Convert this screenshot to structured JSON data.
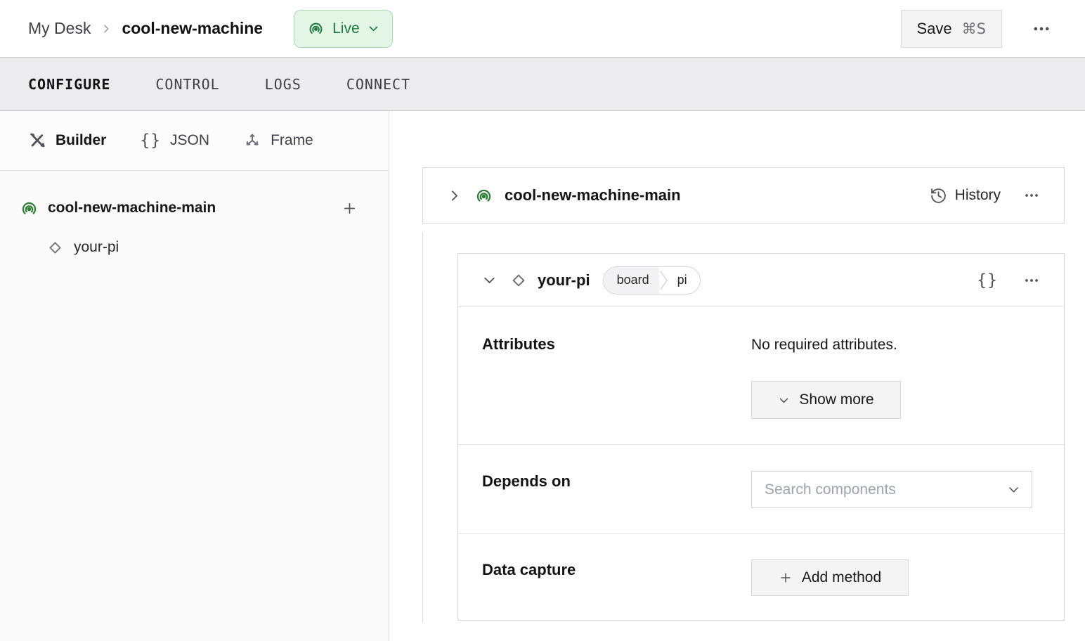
{
  "header": {
    "breadcrumb": {
      "parent": "My Desk",
      "current": "cool-new-machine"
    },
    "live_badge": {
      "label": "Live",
      "status_bg": "#e3f6e6",
      "status_border": "#a7d9b1",
      "status_text": "#1e7a3c"
    },
    "save_button": {
      "label": "Save",
      "shortcut": "⌘S"
    }
  },
  "tabs": {
    "items": [
      {
        "label": "CONFIGURE",
        "active": true
      },
      {
        "label": "CONTROL",
        "active": false
      },
      {
        "label": "LOGS",
        "active": false
      },
      {
        "label": "CONNECT",
        "active": false
      }
    ]
  },
  "sidebar": {
    "views": [
      {
        "label": "Builder",
        "icon": "crossed-tools-icon",
        "active": true
      },
      {
        "label": "JSON",
        "icon": "braces-icon",
        "active": false
      },
      {
        "label": "Frame",
        "icon": "axes-icon",
        "active": false
      }
    ],
    "json_icon_glyph": "{}",
    "tree": [
      {
        "label": "cool-new-machine-main",
        "icon": "broadcast-icon",
        "level": 0
      },
      {
        "label": "your-pi",
        "icon": "diamond-icon",
        "level": 1
      }
    ]
  },
  "main": {
    "machine_card": {
      "title": "cool-new-machine-main",
      "history_label": "History"
    },
    "component_card": {
      "name": "your-pi",
      "type_badge": {
        "type": "board",
        "model": "pi"
      },
      "braces_glyph": "{}",
      "attributes": {
        "label": "Attributes",
        "empty_text": "No required attributes.",
        "show_more_label": "Show more"
      },
      "depends_on": {
        "label": "Depends on",
        "placeholder": "Search components"
      },
      "data_capture": {
        "label": "Data capture",
        "add_method_label": "Add method"
      }
    }
  },
  "colors": {
    "accent_green": "#2b7d2f",
    "live_bg": "#e3f6e6",
    "live_border": "#a7d9b1",
    "live_text": "#1e7a3c",
    "tab_bar_bg": "#ececee",
    "sidebar_bg": "#fafafa",
    "button_bg": "#f4f4f5",
    "card_border": "#d6d6da",
    "divider": "#e4e4e7",
    "text_primary": "#18181b",
    "text_secondary": "#52525b",
    "placeholder_text": "#9aa3ae"
  }
}
